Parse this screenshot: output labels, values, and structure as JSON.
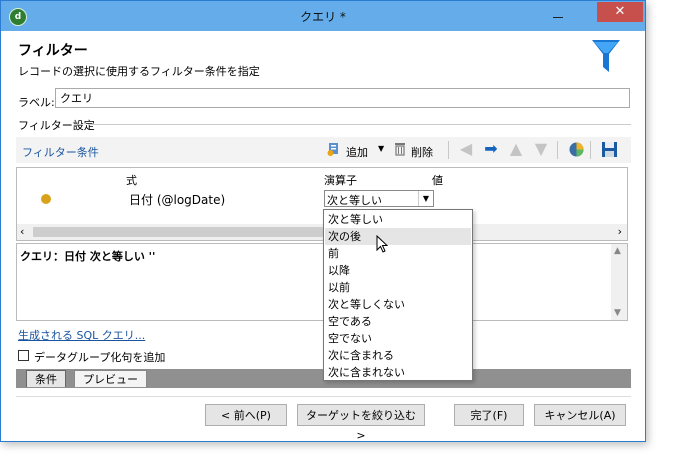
{
  "window": {
    "title": "クエリ *",
    "app_icon_text": "d"
  },
  "header": {
    "title": "フィルター",
    "subtitle": "レコードの選択に使用するフィルター条件を指定"
  },
  "label_field": {
    "label": "ラベル:",
    "value": "クエリ"
  },
  "section": {
    "label": "フィルター設定"
  },
  "toolbar": {
    "title": "フィルター条件",
    "add_label": "追加",
    "delete_label": "削除",
    "dropdown_glyph": "▼"
  },
  "grid": {
    "columns": [
      "式",
      "演算子",
      "値"
    ],
    "row": {
      "expression": "日付 (@logDate)",
      "operator": "次と等しい"
    }
  },
  "query_text": "クエリ：日付 次と等しい ''",
  "sql_link": "生成される SQL クエリ...",
  "group_checkbox": {
    "label": "データグループ化句を追加",
    "checked": false
  },
  "tabs": [
    "条件",
    "プレビュー"
  ],
  "buttons": {
    "back": "< 前へ(P)",
    "target": "ターゲットを絞り込む>",
    "finish": "完了(F)",
    "cancel": "キャンセル(A)"
  },
  "operator_dropdown": {
    "options": [
      "次と等しい",
      "次の後",
      "前",
      "以降",
      "以前",
      "次と等しくない",
      "空である",
      "空でない",
      "次に含まれる",
      "次に含まれない"
    ],
    "highlighted_index": 1
  },
  "colors": {
    "titlebar": "#64adea",
    "close": "#c74f4c",
    "accent": "#1a55a0",
    "funnel": "#1976d2",
    "status_dot": "#d9a21b"
  }
}
